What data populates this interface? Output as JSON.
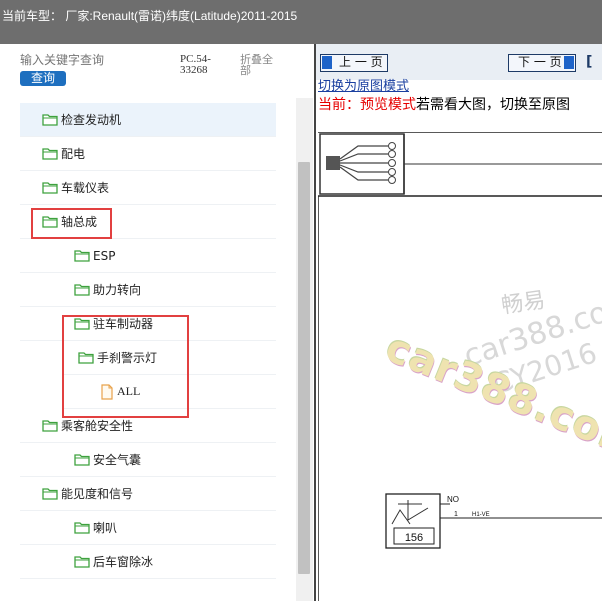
{
  "header": {
    "title": "当前车型：  厂家:Renault(雷诺)纬度(Latitude)2011-2015"
  },
  "search": {
    "placeholder": "输入关键字查询",
    "button_label": "查询",
    "pc_number": "PC.54-33268",
    "collapse_all": "折叠全部"
  },
  "tree": {
    "items": [
      {
        "label": "检查发动机",
        "icon": "folder-icon",
        "level": 1,
        "selected": true
      },
      {
        "label": "配电",
        "icon": "folder-icon",
        "level": 1
      },
      {
        "label": "车载仪表",
        "icon": "folder-icon",
        "level": 1
      },
      {
        "label": "轴总成",
        "icon": "folder-icon",
        "level": 1
      },
      {
        "label": "ESP",
        "icon": "folder-icon",
        "level": 2
      },
      {
        "label": "助力转向",
        "icon": "folder-icon",
        "level": 2
      },
      {
        "label": "驻车制动器",
        "icon": "folder-icon",
        "level": 2
      },
      {
        "label": "手刹警示灯",
        "icon": "folder-icon",
        "level": 3
      },
      {
        "label": "ALL",
        "icon": "document-icon",
        "level": 4
      },
      {
        "label": "乘客舱安全性",
        "icon": "folder-icon",
        "level": 1
      },
      {
        "label": "安全气囊",
        "icon": "folder-icon",
        "level": 2
      },
      {
        "label": "能见度和信号",
        "icon": "folder-icon",
        "level": 1
      },
      {
        "label": "喇叭",
        "icon": "folder-icon",
        "level": 2
      },
      {
        "label": "后车窗除冰",
        "icon": "folder-icon",
        "level": 2
      }
    ]
  },
  "viewer": {
    "prev_label": "上 一 页",
    "next_label": "下 一 页",
    "switch_link": "切换为原图模式",
    "mode_prefix": "当前：预览模式",
    "mode_suffix": "若需看大图，切换至原图",
    "diagram": {
      "box_number": "156",
      "wire_no": "NO",
      "pin": "1",
      "wire_label": "H1-VE"
    }
  },
  "watermark": {
    "line1": "畅易",
    "line2": "car388.con",
    "line3": "CY2016",
    "logo": "car388.com"
  },
  "colors": {
    "accent": "#1e6fbf",
    "highlight_box": "#e24040",
    "folder": "#3ea23e"
  }
}
